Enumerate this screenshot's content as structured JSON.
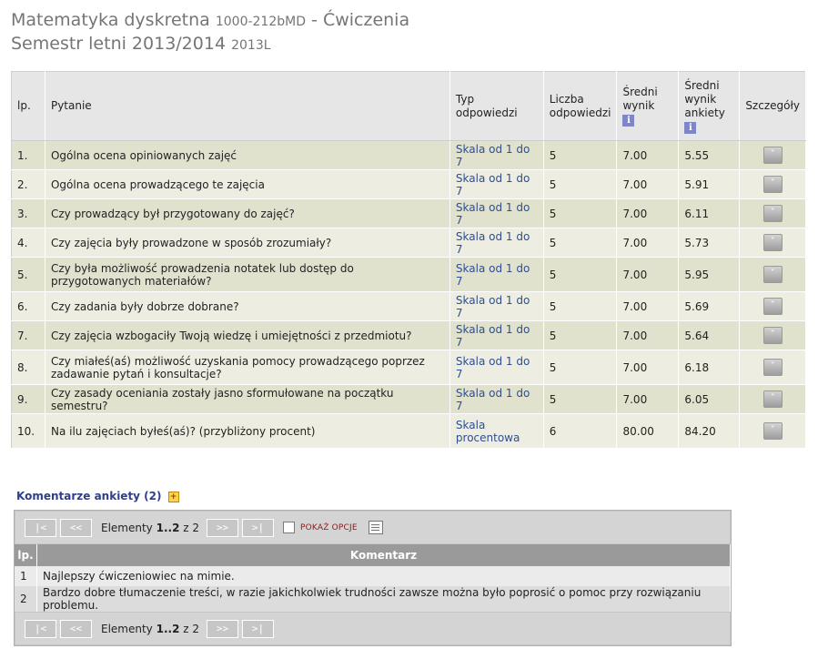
{
  "header": {
    "course_name": "Matematyka dyskretna",
    "course_code": "1000-212bMD",
    "course_type": "- Ćwiczenia",
    "semester_name": "Semestr letni 2013/2014",
    "semester_code": "2013L"
  },
  "table": {
    "headers": {
      "lp": "lp.",
      "pytanie": "Pytanie",
      "typ": "Typ odpowiedzi",
      "liczba": "Liczba odpowiedzi",
      "sredni_wynik": "Średni wynik",
      "sredni_ankiety": "Średni wynik ankiety",
      "szczegoly": "Szczegóły"
    },
    "info_icon": "i",
    "details_icon": "˅",
    "rows": [
      {
        "lp": "1.",
        "question": "Ogólna ocena opiniowanych zajęć",
        "type": "Skala od 1 do 7",
        "count": "5",
        "avg": "7.00",
        "survey": "5.55"
      },
      {
        "lp": "2.",
        "question": "Ogólna ocena prowadzącego te zajęcia",
        "type": "Skala od 1 do 7",
        "count": "5",
        "avg": "7.00",
        "survey": "5.91"
      },
      {
        "lp": "3.",
        "question": "Czy prowadzący był przygotowany do zajęć?",
        "type": "Skala od 1 do 7",
        "count": "5",
        "avg": "7.00",
        "survey": "6.11"
      },
      {
        "lp": "4.",
        "question": "Czy zajęcia były prowadzone w sposób zrozumiały?",
        "type": "Skala od 1 do 7",
        "count": "5",
        "avg": "7.00",
        "survey": "5.73"
      },
      {
        "lp": "5.",
        "question": "Czy była możliwość prowadzenia notatek lub dostęp do przygotowanych materiałów?",
        "type": "Skala od 1 do 7",
        "count": "5",
        "avg": "7.00",
        "survey": "5.95"
      },
      {
        "lp": "6.",
        "question": "Czy zadania były dobrze dobrane?",
        "type": "Skala od 1 do 7",
        "count": "5",
        "avg": "7.00",
        "survey": "5.69"
      },
      {
        "lp": "7.",
        "question": "Czy zajęcia wzbogaciły Twoją wiedzę i umiejętności z przedmiotu?",
        "type": "Skala od 1 do 7",
        "count": "5",
        "avg": "7.00",
        "survey": "5.64"
      },
      {
        "lp": "8.",
        "question": "Czy miałeś(aś) możliwość uzyskania pomocy prowadzącego poprzez zadawanie pytań i konsultacje?",
        "type": "Skala od 1 do 7",
        "count": "5",
        "avg": "7.00",
        "survey": "6.18"
      },
      {
        "lp": "9.",
        "question": "Czy zasady oceniania zostały jasno sformułowane na początku semestru?",
        "type": "Skala od 1 do 7",
        "count": "5",
        "avg": "7.00",
        "survey": "6.05"
      },
      {
        "lp": "10.",
        "question": "Na ilu zajęciach byłeś(aś)? (przybliżony procent)",
        "type": "Skala procentowa",
        "count": "6",
        "avg": "80.00",
        "survey": "84.20"
      }
    ]
  },
  "comments": {
    "title": "Komentarze ankiety (2)",
    "plus_icon": "+",
    "nav": {
      "first": "|<",
      "prev": "<<",
      "next": ">>",
      "last": ">|",
      "elements_prefix": "Elementy ",
      "range": "1..2",
      "of_text": " z 2",
      "show_options": "POKAŻ OPCJE"
    },
    "headers": {
      "lp": "lp.",
      "comment": "Komentarz"
    },
    "rows": [
      {
        "lp": "1",
        "text": "Najlepszy ćwiczeniowiec na mimie."
      },
      {
        "lp": "2",
        "text": "Bardzo dobre tłumaczenie treści, w razie jakichkolwiek trudności zawsze można było poprosić o pomoc przy rozwiązaniu problemu."
      }
    ]
  }
}
